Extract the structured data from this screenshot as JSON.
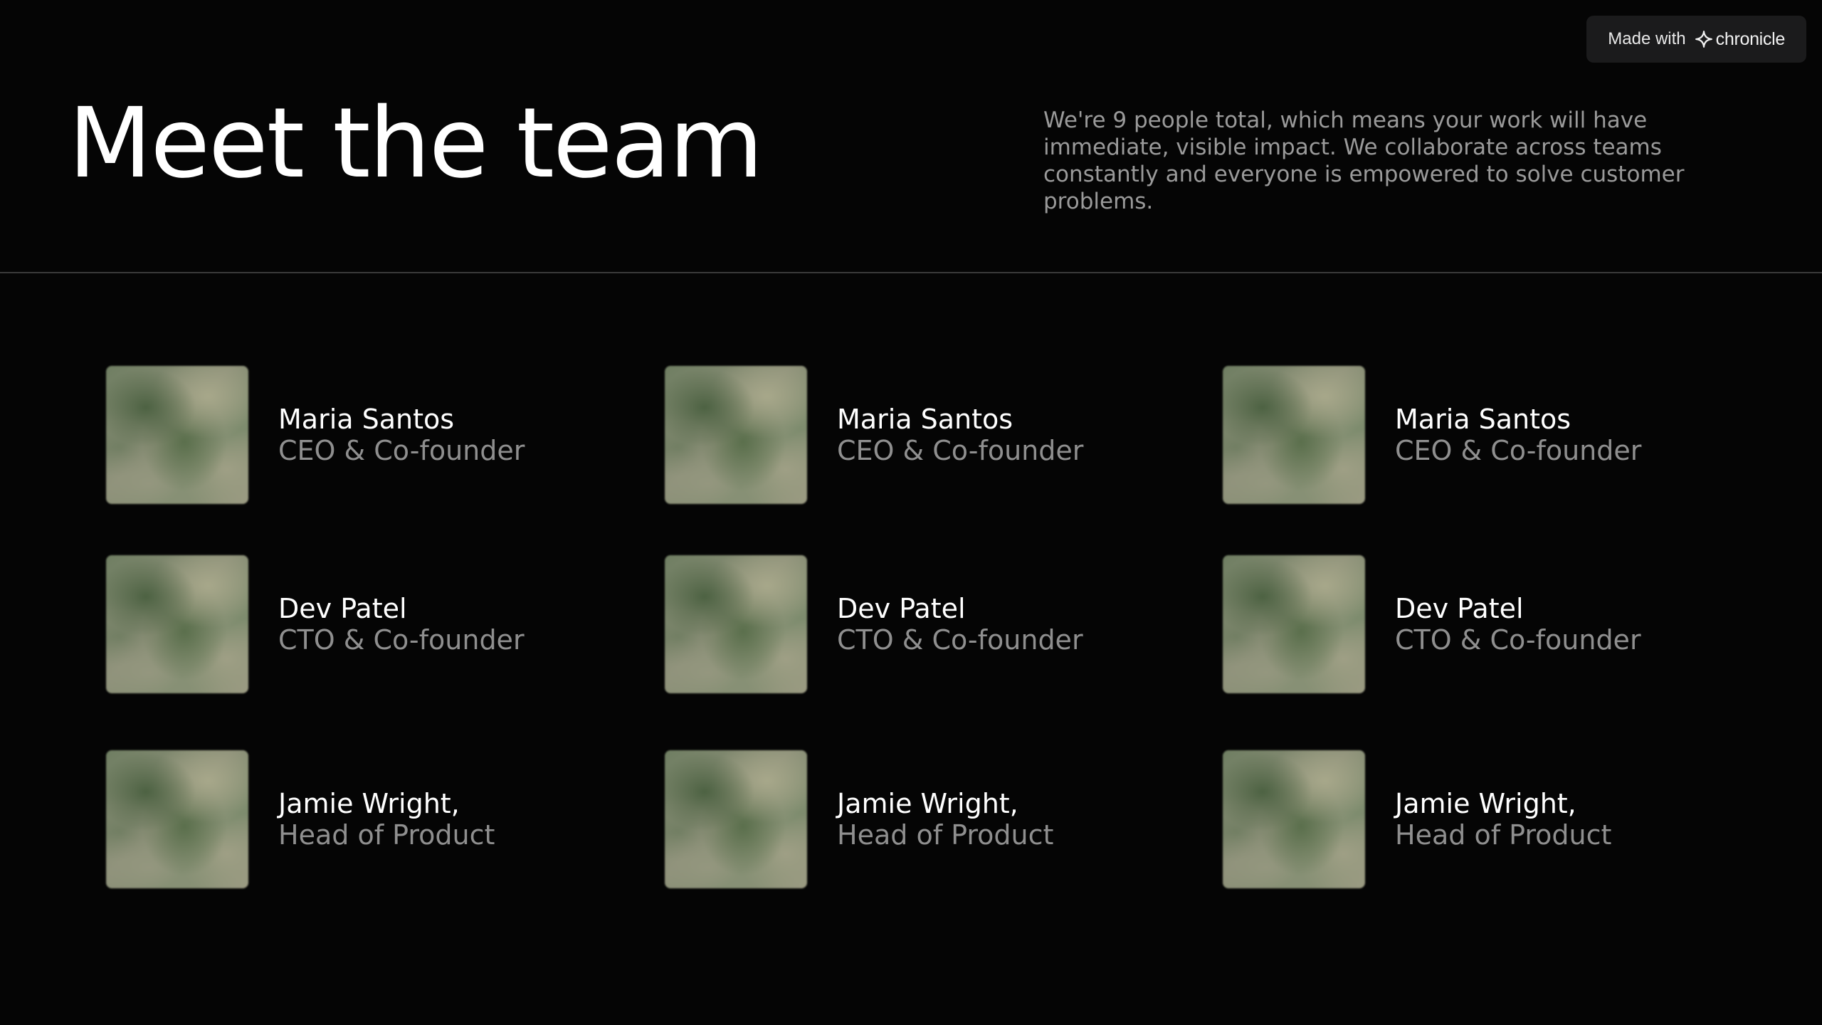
{
  "badge": {
    "prefix": "Made with",
    "brand": "chronicle"
  },
  "header": {
    "title": "Meet the team",
    "intro": "We're 9 people total, which means your work will have immediate, visible impact. We collaborate across teams constantly and everyone is empowered to solve customer problems."
  },
  "team": [
    {
      "name": "Maria Santos",
      "role": "CEO & Co-founder"
    },
    {
      "name": "Maria Santos",
      "role": "CEO & Co-founder"
    },
    {
      "name": "Maria Santos",
      "role": "CEO & Co-founder"
    },
    {
      "name": "Dev Patel",
      "role": "CTO & Co-founder"
    },
    {
      "name": "Dev Patel",
      "role": "CTO & Co-founder"
    },
    {
      "name": "Dev Patel",
      "role": "CTO & Co-founder"
    },
    {
      "name": "Jamie Wright,",
      "role": "Head of Product"
    },
    {
      "name": "Jamie Wright,",
      "role": "Head of Product"
    },
    {
      "name": "Jamie Wright,",
      "role": "Head of Product"
    }
  ]
}
